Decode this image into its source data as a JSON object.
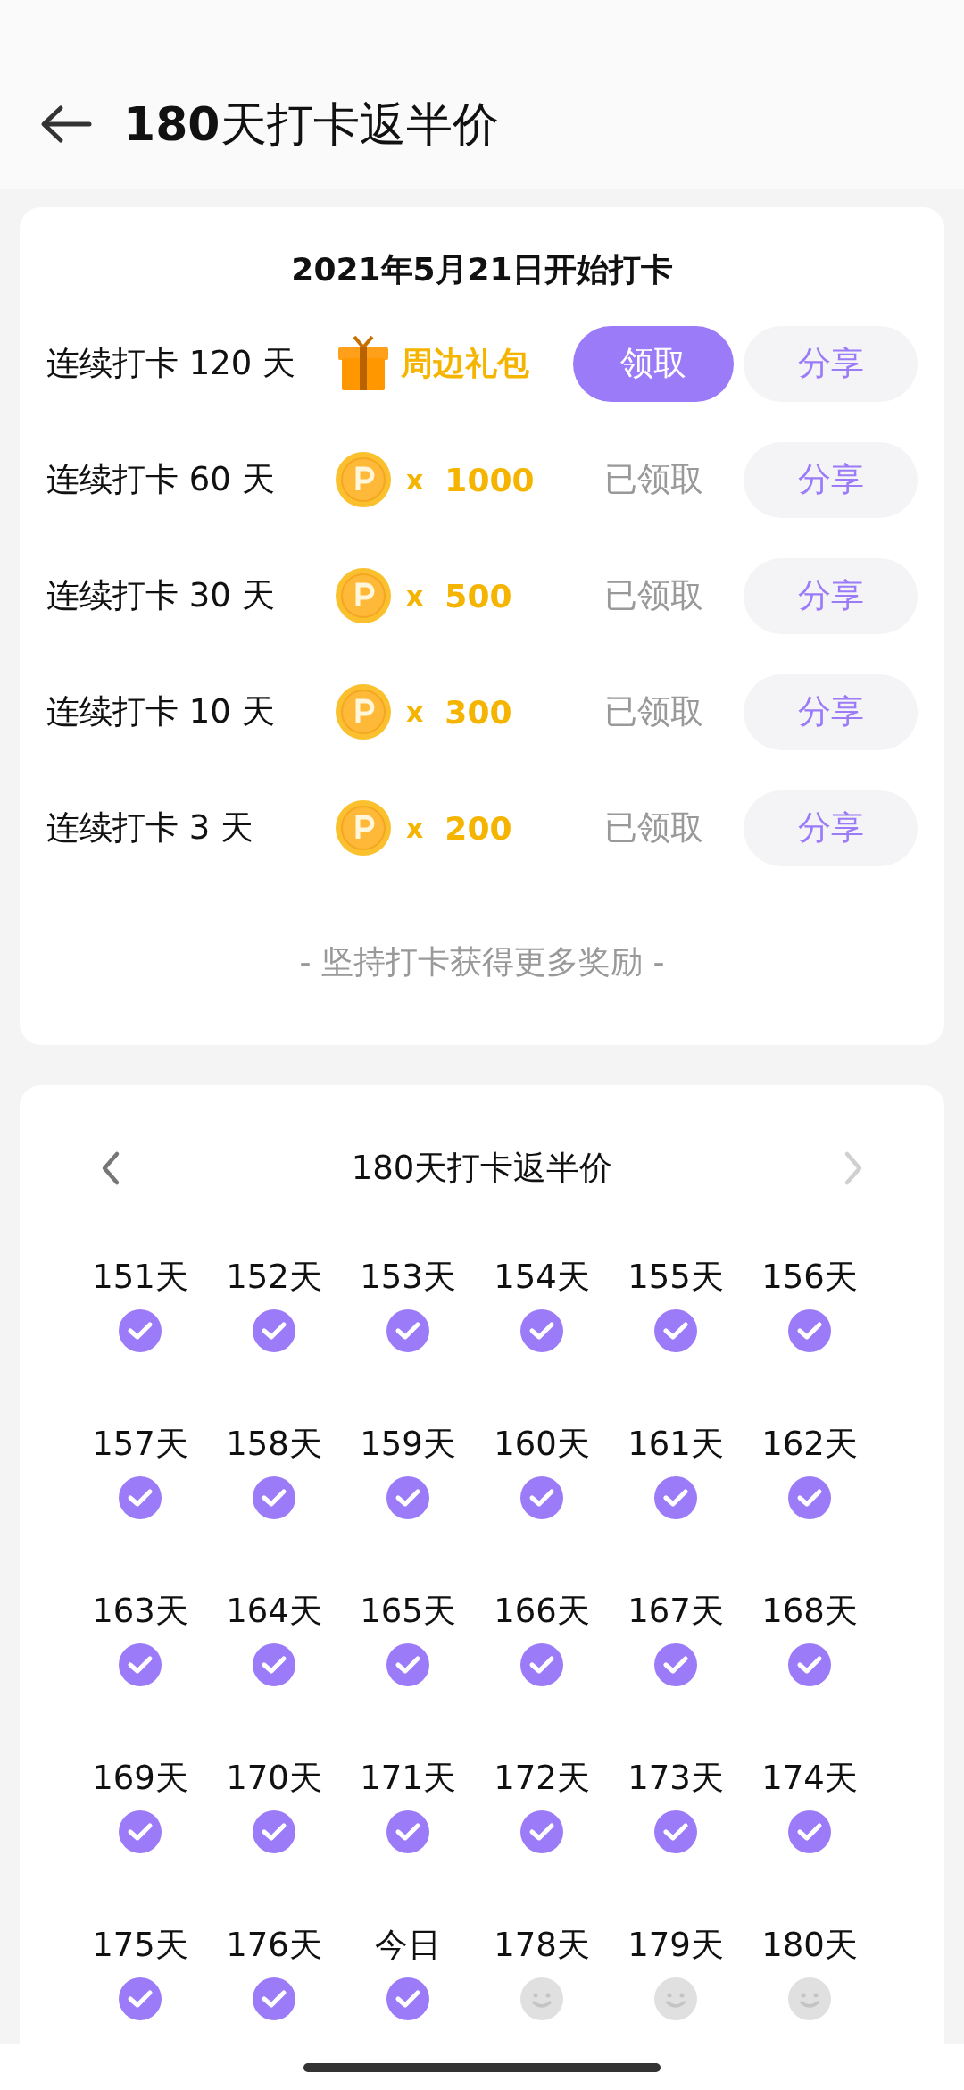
{
  "header": {
    "title": "**180**天打卡返半价"
  },
  "rewards_card": {
    "start_date": "2021年5月21日开始打卡",
    "rewards": [
      {
        "label": "连续打卡 120 天",
        "kind": "gift",
        "prize": "周边礼包",
        "claimed": false,
        "action": "领取",
        "share": "分享"
      },
      {
        "label": "连续打卡 60 天",
        "kind": "coins",
        "multiplier": "x",
        "prize": "1000",
        "claimed": true,
        "action": "已领取",
        "share": "分享"
      },
      {
        "label": "连续打卡 30 天",
        "kind": "coins",
        "multiplier": "x",
        "prize": "500",
        "claimed": true,
        "action": "已领取",
        "share": "分享"
      },
      {
        "label": "连续打卡 10 天",
        "kind": "coins",
        "multiplier": "x",
        "prize": "300",
        "claimed": true,
        "action": "已领取",
        "share": "分享"
      },
      {
        "label": "连续打卡 3 天",
        "kind": "coins",
        "multiplier": "x",
        "prize": "200",
        "claimed": true,
        "action": "已领取",
        "share": "分享"
      }
    ],
    "footer": "- 坚持打卡获得更多奖励 -"
  },
  "calendar": {
    "title": "180天打卡返半价",
    "prev_disabled": false,
    "next_disabled": true,
    "days": [
      {
        "label": "151天",
        "checked": true
      },
      {
        "label": "152天",
        "checked": true
      },
      {
        "label": "153天",
        "checked": true
      },
      {
        "label": "154天",
        "checked": true
      },
      {
        "label": "155天",
        "checked": true
      },
      {
        "label": "156天",
        "checked": true
      },
      {
        "label": "157天",
        "checked": true
      },
      {
        "label": "158天",
        "checked": true
      },
      {
        "label": "159天",
        "checked": true
      },
      {
        "label": "160天",
        "checked": true
      },
      {
        "label": "161天",
        "checked": true
      },
      {
        "label": "162天",
        "checked": true
      },
      {
        "label": "163天",
        "checked": true
      },
      {
        "label": "164天",
        "checked": true
      },
      {
        "label": "165天",
        "checked": true
      },
      {
        "label": "166天",
        "checked": true
      },
      {
        "label": "167天",
        "checked": true
      },
      {
        "label": "168天",
        "checked": true
      },
      {
        "label": "169天",
        "checked": true
      },
      {
        "label": "170天",
        "checked": true
      },
      {
        "label": "171天",
        "checked": true
      },
      {
        "label": "172天",
        "checked": true
      },
      {
        "label": "173天",
        "checked": true
      },
      {
        "label": "174天",
        "checked": true
      },
      {
        "label": "175天",
        "checked": true
      },
      {
        "label": "176天",
        "checked": true
      },
      {
        "label": "今日",
        "checked": true
      },
      {
        "label": "178天",
        "checked": false
      },
      {
        "label": "179天",
        "checked": false
      },
      {
        "label": "180天",
        "checked": false
      }
    ]
  }
}
